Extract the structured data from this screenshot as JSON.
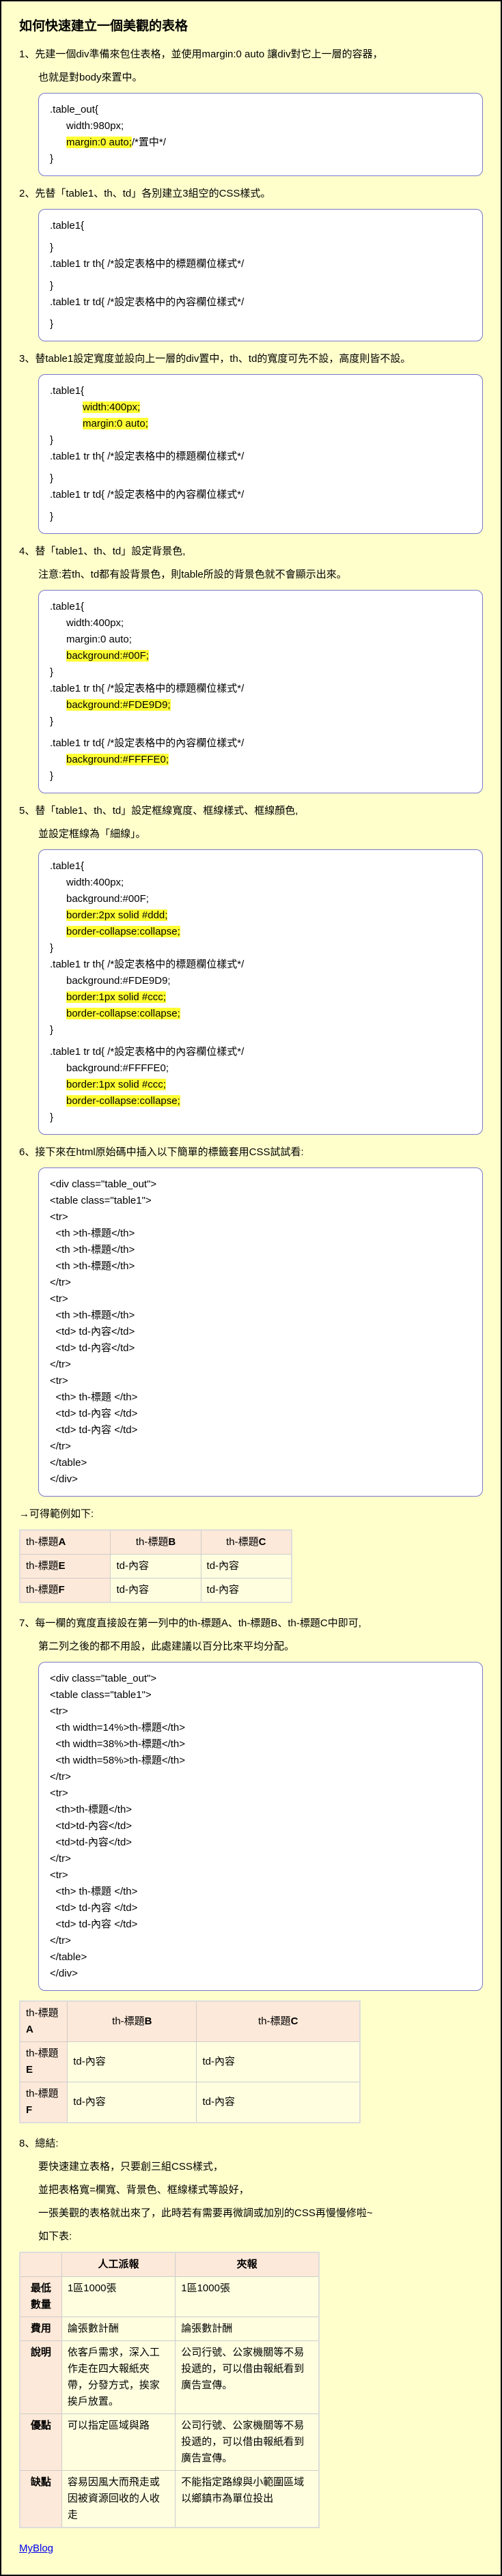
{
  "title": "如何快速建立一個美觀的表格",
  "step1": "1、先建一個div準備來包住表格，並使用margin:0 auto 讓div對它上一層的容器，",
  "step1b": "也就是對body來置中。",
  "code1": {
    "l1": ".table_out{",
    "l2": "width:980px;",
    "l3": "margin:0 auto;",
    "l3c": "/*置中*/",
    "l4": "}"
  },
  "step2": "2、先替「table1、th、td」各別建立3組空的CSS樣式。",
  "code2": {
    "l1": ".table1{",
    "l2": "}",
    "l3": ".table1 tr th{ /*設定表格中的標題欄位樣式*/",
    "l4": "}",
    "l5": ".table1 tr td{ /*設定表格中的內容欄位樣式*/",
    "l6": "}"
  },
  "step3": "3、替table1設定寬度並設向上一層的div置中，th、td的寬度可先不設，高度則皆不設。",
  "code3": {
    "l1": ".table1{",
    "l2": "width:400px;",
    "l3": "margin:0 auto;",
    "l4": "}",
    "l5": ".table1 tr th{ /*設定表格中的標題欄位樣式*/",
    "l6": "}",
    "l7": ".table1 tr td{ /*設定表格中的內容欄位樣式*/",
    "l8": "}"
  },
  "step4": "4、替「table1、th、td」設定背景色,",
  "step4b": "注意:若th、td都有設背景色，則table所設的背景色就不會顯示出來。",
  "code4": {
    "l1": ".table1{",
    "l2": "width:400px;",
    "l3": "margin:0 auto;",
    "l4": "background:#00F;",
    "l5": "}",
    "l6": ".table1 tr th{ /*設定表格中的標題欄位樣式*/",
    "l7": "background:#FDE9D9;",
    "l8": "}",
    "l9": ".table1 tr td{ /*設定表格中的內容欄位樣式*/",
    "l10": "background:#FFFFE0;",
    "l11": "}"
  },
  "step5": "5、替「table1、th、td」設定框線寬度、框線樣式、框線顏色,",
  "step5b": "並設定框線為「細線」。",
  "code5": {
    "l1": ".table1{",
    "l2": "width:400px;",
    "l3": "background:#00F;",
    "l4": "border:2px solid #ddd;",
    "l5": "border-collapse:collapse;",
    "l6": "}",
    "l7": ".table1 tr th{ /*設定表格中的標題欄位樣式*/",
    "l8": "background:#FDE9D9;",
    "l9": "border:1px solid #ccc;",
    "l10": "border-collapse:collapse;",
    "l11": "}",
    "l12": ".table1 tr td{ /*設定表格中的內容欄位樣式*/",
    "l13": "background:#FFFFE0;",
    "l14": "border:1px solid #ccc;",
    "l15": "border-collapse:collapse;",
    "l16": "}"
  },
  "step6": "6、接下來在html原始碼中插入以下簡單的標籤套用CSS試試看:",
  "code6": {
    "l1": "<div class=\"table_out\">",
    "l2": "<table class=\"table1\">",
    "l3": "<tr>",
    "l4": "  <th >th-標題</th>",
    "l5": "  <th >th-標題</th>",
    "l6": "  <th >th-標題</th>",
    "l7": "</tr>",
    "l8": "<tr>",
    "l9": "  <th >th-標題</th>",
    "l10": "  <td> td-內容</td>",
    "l11": "  <td> td-內容</td>",
    "l12": "</tr>",
    "l13": "<tr>",
    "l14": "  <th> th-標題 </th>",
    "l15": "  <td> td-內容 </td>",
    "l16": "  <td> td-內容 </td>",
    "l17": "</tr>",
    "l18": "</table>",
    "l19": "</div>"
  },
  "ex1_caption": "→可得範例如下:",
  "ex1": {
    "h1": "A",
    "h2": "B",
    "h3": "C",
    "thp": "th-標題",
    "r2p": "E",
    "r3p": "F",
    "c": "td-內容"
  },
  "step7": "7、每一欄的寬度直接設在第一列中的th-標題A、th-標題B、th-標題C中即可,",
  "step7b": "第二列之後的都不用設，此處建議以百分比來平均分配。",
  "code7": {
    "l1": "<div class=\"table_out\">",
    "l2": "<table class=\"table1\">",
    "l3": "<tr>",
    "l4": "  <th width=14%>th-標題</th>",
    "l5": "  <th width=38%>th-標題</th>",
    "l6": "  <th width=58%>th-標題</th>",
    "l7": "</tr>",
    "l8": "<tr>",
    "l9": "  <th>th-標題</th>",
    "l10": "  <td>td-內容</td>",
    "l11": "  <td>td-內容</td>",
    "l12": "</tr>",
    "l13": "<tr>",
    "l14": "  <th> th-標題 </th>",
    "l15": "  <td> td-內容 </td>",
    "l16": "  <td> td-內容 </td>",
    "l17": "</tr>",
    "l18": "</table>",
    "l19": "</div>"
  },
  "step8": "8、總結:",
  "step8b": "要快速建立表格，只要創三組CSS樣式，",
  "step8c": "並把表格寬=欄寬、背景色、框線樣式等設好，",
  "step8d": "一張美觀的表格就出來了，此時若有需要再微調或加別的CSS再慢慢修啦~",
  "step8e": "如下表:",
  "ex3": {
    "h1": "",
    "h2": "人工派報",
    "h3": "夾報",
    "rows": [
      {
        "h": "最低數量",
        "c1": "1區1000張",
        "c2": "1區1000張"
      },
      {
        "h": "費用",
        "c1": "論張數計酬",
        "c2": "論張數計酬"
      },
      {
        "h": "說明",
        "c1": "依客戶需求，深入工作走在四大報紙夾帶，分發方式，挨家挨戶放置。",
        "c2": "公司行號、公家機關等不易投遞的，可以借由報紙看到廣告宣傳。"
      },
      {
        "h": "優點",
        "c1": "可以指定區域與路",
        "c2": "公司行號、公家機關等不易投遞的，可以借由報紙看到廣告宣傳。"
      },
      {
        "h": "缺點",
        "c1": "容易因風大而飛走或因被資源回收的人收走",
        "c2": "不能指定路線與小範圍區域\n以鄉鎮市為單位投出"
      }
    ]
  },
  "bloglink": "MyBlog"
}
